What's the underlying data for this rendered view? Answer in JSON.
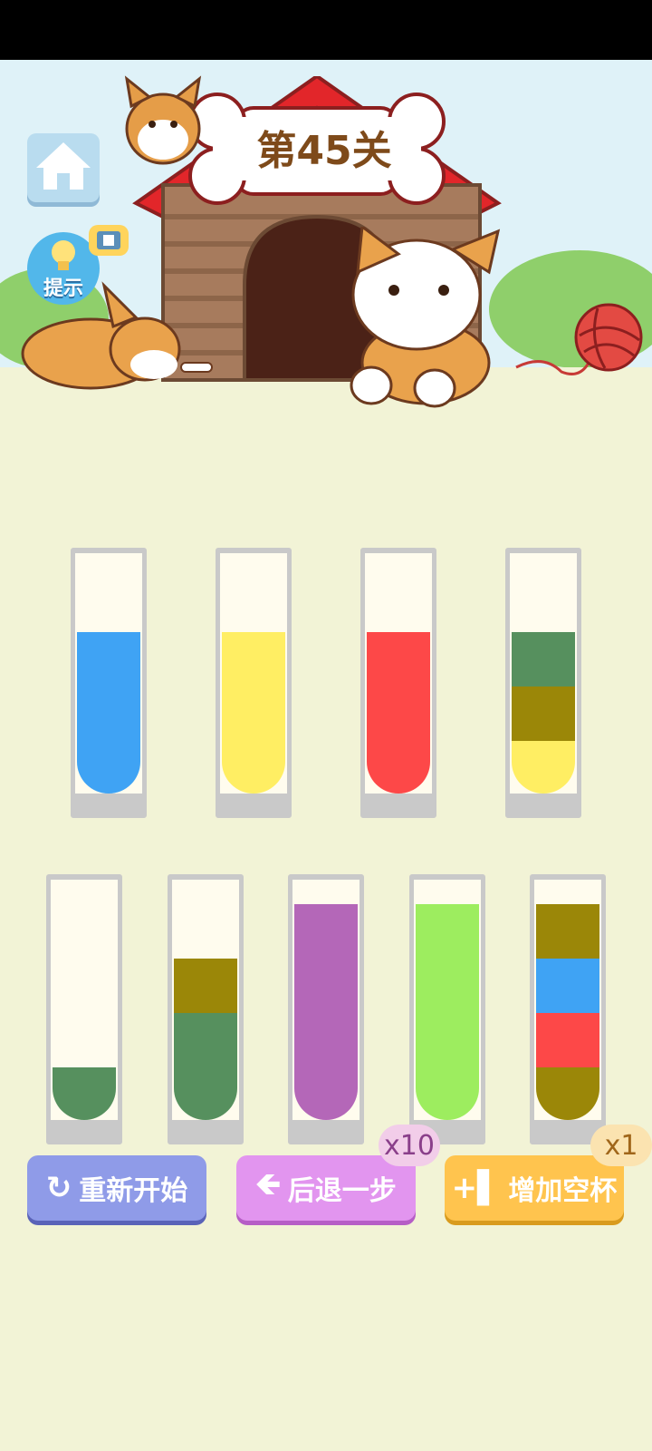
{
  "level": {
    "title": "第45关"
  },
  "hint": {
    "label": "提示"
  },
  "icons": {
    "home": "home-icon",
    "hint": "lightbulb-icon",
    "video": "film-icon",
    "restart": "refresh-icon",
    "undo": "arrow-left-icon",
    "add": "add-tube-icon"
  },
  "colors": {
    "blue": "#3fa3f4",
    "yellow": "#ffee63",
    "red": "#fd4848",
    "green": "#56905e",
    "olive": "#9b8708",
    "purple": "#b467b8",
    "lime": "#9ded5f"
  },
  "tubes": [
    {
      "layers": [
        "blue",
        "blue",
        "blue"
      ]
    },
    {
      "layers": [
        "yellow",
        "yellow",
        "yellow"
      ]
    },
    {
      "layers": [
        "red",
        "red",
        "red"
      ]
    },
    {
      "layers": [
        "yellow",
        "olive",
        "green"
      ]
    },
    {
      "layers": [
        "green"
      ]
    },
    {
      "layers": [
        "green",
        "green",
        "olive"
      ]
    },
    {
      "layers": [
        "purple",
        "purple",
        "purple",
        "purple"
      ]
    },
    {
      "layers": [
        "lime",
        "lime",
        "lime",
        "lime"
      ]
    },
    {
      "layers": [
        "olive",
        "red",
        "blue",
        "olive"
      ]
    }
  ],
  "buttons": {
    "restart": {
      "label": "重新开始"
    },
    "undo": {
      "label": "后退一步",
      "count": "x10"
    },
    "add_cup": {
      "label": "增加空杯",
      "count": "x1"
    }
  }
}
